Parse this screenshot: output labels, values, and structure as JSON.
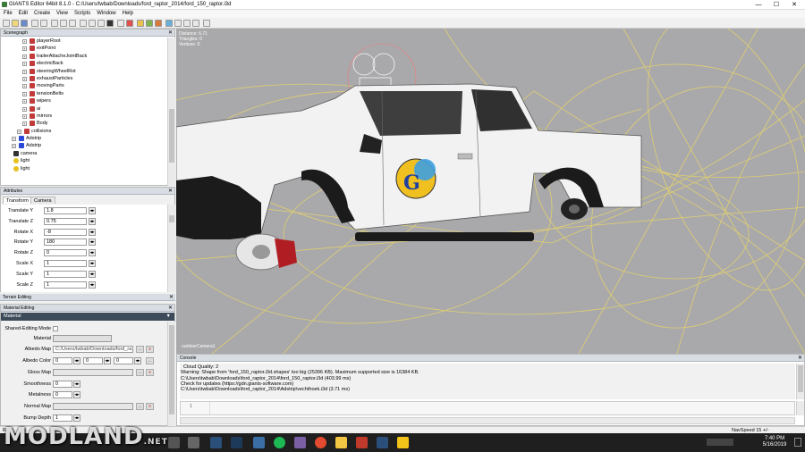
{
  "window": {
    "title": "GIANTS Editor 64bit 8.1.0 - C:/Users/twbab/Downloads/ford_raptor_2014/ford_150_raptor.i3d",
    "minimize": "—",
    "maximize": "☐",
    "close": "✕"
  },
  "menu": [
    "File",
    "Edit",
    "Create",
    "View",
    "Scripts",
    "Window",
    "Help"
  ],
  "scenegraph": {
    "title": "Scenegraph",
    "nodes": [
      {
        "label": "playerRoot",
        "depth": 3,
        "icon": "transform-group-icon"
      },
      {
        "label": "exitPoint",
        "depth": 3,
        "icon": "transform-group-icon"
      },
      {
        "label": "trailerAttacheJointBack",
        "depth": 3,
        "icon": "transform-group-icon"
      },
      {
        "label": "electricBack",
        "depth": 3,
        "icon": "transform-group-icon"
      },
      {
        "label": "steeringWheelRot",
        "depth": 3,
        "icon": "transform-group-icon"
      },
      {
        "label": "exhaustParticles",
        "depth": 3,
        "icon": "transform-group-icon"
      },
      {
        "label": "movingParts",
        "depth": 3,
        "icon": "transform-group-icon"
      },
      {
        "label": "tensionBelts",
        "depth": 3,
        "icon": "transform-group-icon"
      },
      {
        "label": "wipers",
        "depth": 3,
        "icon": "transform-group-icon"
      },
      {
        "label": "ai",
        "depth": 3,
        "icon": "transform-group-icon"
      },
      {
        "label": "mirrors",
        "depth": 3,
        "icon": "transform-group-icon"
      },
      {
        "label": "Body",
        "depth": 3,
        "icon": "transform-group-icon"
      },
      {
        "label": "collisions",
        "depth": 2,
        "icon": "transform-group-icon"
      },
      {
        "label": "Adstrip",
        "depth": 1,
        "icon": "shape-icon"
      },
      {
        "label": "Adstrip",
        "depth": 1,
        "icon": "shape-icon"
      },
      {
        "label": "camera",
        "depth": 0,
        "icon": "camera-icon"
      },
      {
        "label": "light",
        "depth": 0,
        "icon": "light-icon"
      },
      {
        "label": "light",
        "depth": 0,
        "icon": "light-icon"
      }
    ]
  },
  "attributes": {
    "title": "Attributes",
    "tabs": [
      "Transform",
      "Camera"
    ],
    "rows": [
      {
        "label": "Translate Y",
        "value": "1.8"
      },
      {
        "label": "Translate Z",
        "value": "0.75"
      },
      {
        "label": "Rotate X",
        "value": "-8"
      },
      {
        "label": "Rotate Y",
        "value": "180"
      },
      {
        "label": "Rotate Z",
        "value": "0"
      },
      {
        "label": "Scale X",
        "value": "1"
      },
      {
        "label": "Scale Y",
        "value": "1"
      },
      {
        "label": "Scale Z",
        "value": "1"
      }
    ]
  },
  "terrain": {
    "title": "Terrain Editing"
  },
  "material": {
    "title": "Material Editing",
    "section": "Material",
    "shared_label": "Shared-Editing Mode",
    "material_label": "Material",
    "albedo_map_label": "Albedo Map",
    "albedo_map_value": "C:/Users/twbab/Downloads/ford_ra",
    "albedo_color_label": "Albedo Color",
    "albedo_color": [
      "0",
      "0",
      "0"
    ],
    "gloss_map_label": "Gloss Map",
    "smoothness_label": "Smoothness",
    "smoothness_value": "0",
    "metalness_label": "Metalness",
    "metalness_value": "0",
    "normal_map_label": "Normal Map",
    "bump_depth_label": "Bump Depth",
    "bump_depth_value": "1",
    "browse": "...",
    "clear": "x",
    "spin": "◂▸"
  },
  "viewport": {
    "stats": [
      "Distance: 6.71",
      "Triangles: 0",
      "Vertices: 0"
    ],
    "camera_label": "outdoorCamera1",
    "body_color": "#f2f2f2",
    "trim_color": "#1b1b1b",
    "grid_color": "#e6d36b",
    "brake_color": "#b01e24"
  },
  "console": {
    "title": "Console",
    "lines": [
      "Cloud Quality: 2",
      "Warning: Shape from 'ford_150_raptor.i3d.shapes' too big (25396 KB).  Maximum supported size is 16384 KB.",
      "C:\\Users\\twbab\\Downloads\\ford_raptor_2014\\ford_150_raptor.i3d (403.99 ms)",
      "Check for updates (https://gdn.giants-software.com)",
      "C:\\Users\\twbab\\Downloads\\ford_raptor_2014\\Adstrip\\vechthoek.i3d (3.71 ms)"
    ],
    "line_number": "1"
  },
  "status": {
    "left": "Rea",
    "navspeed": "NavSpeed 15 +/-"
  },
  "taskbar": {
    "time": "7:40 PM",
    "date": "5/16/2019"
  },
  "watermark": {
    "main": "MODLAND",
    "suffix": ".NET"
  }
}
